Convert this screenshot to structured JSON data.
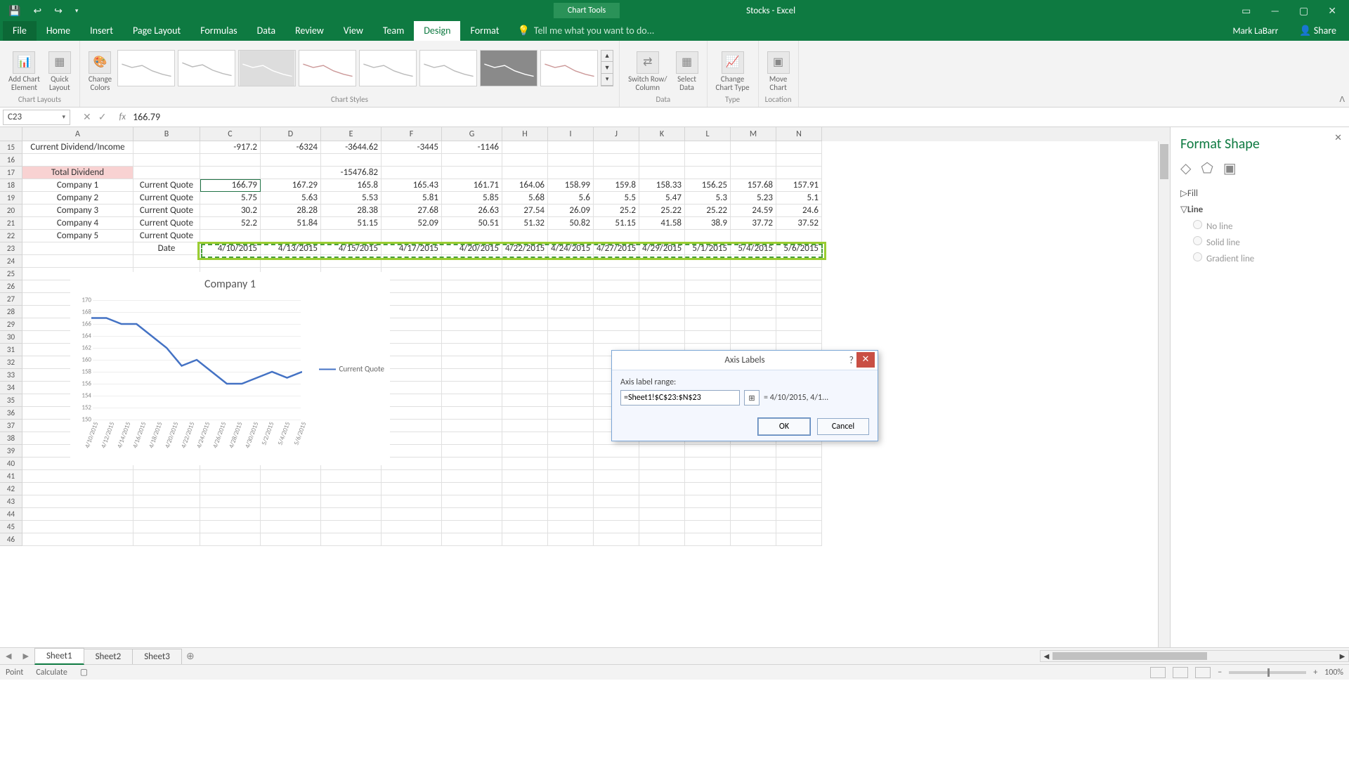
{
  "window": {
    "contextual_label": "Chart Tools",
    "title": "Stocks - Excel",
    "user": "Mark LaBarr",
    "share": "Share"
  },
  "tabs": {
    "file": "File",
    "home": "Home",
    "insert": "Insert",
    "pagelayout": "Page Layout",
    "formulas": "Formulas",
    "data": "Data",
    "review": "Review",
    "view": "View",
    "team": "Team",
    "design": "Design",
    "format": "Format",
    "tellme": "Tell me what you want to do..."
  },
  "ribbon": {
    "add_chart_element": "Add Chart\nElement",
    "quick_layout": "Quick\nLayout",
    "change_colors": "Change\nColors",
    "group_chart_layouts": "Chart Layouts",
    "group_chart_styles": "Chart Styles",
    "switch_row": "Switch Row/\nColumn",
    "select_data": "Select\nData",
    "group_data": "Data",
    "change_type": "Change\nChart Type",
    "group_type": "Type",
    "move_chart": "Move\nChart",
    "group_location": "Location"
  },
  "namebox": "C23",
  "formula": "166.79",
  "columns": [
    "A",
    "B",
    "C",
    "D",
    "E",
    "F",
    "G",
    "H",
    "I",
    "J",
    "K",
    "L",
    "M",
    "N"
  ],
  "row_numbers": [
    15,
    16,
    17,
    18,
    19,
    20,
    21,
    22,
    23,
    24,
    25,
    26,
    27,
    28,
    29,
    30,
    31,
    32,
    33,
    34,
    35,
    36,
    37,
    38,
    39,
    40,
    41,
    42,
    43,
    44,
    45,
    46
  ],
  "cells": {
    "r15": {
      "A": "Current Dividend/Income",
      "C": "-917.2",
      "D": "-6324",
      "E": "-3644.62",
      "F": "-3445",
      "G": "-1146"
    },
    "r17": {
      "A": "Total Dividend",
      "E": "-15476.82"
    },
    "r18": {
      "A": "Company 1",
      "B": "Current Quote",
      "C": "166.79",
      "D": "167.29",
      "E": "165.8",
      "F": "165.43",
      "G": "161.71",
      "H": "164.06",
      "I": "158.99",
      "J": "159.8",
      "K": "158.33",
      "L": "156.25",
      "M": "157.68",
      "N": "157.91"
    },
    "r19": {
      "A": "Company 2",
      "B": "Current Quote",
      "C": "5.75",
      "D": "5.63",
      "E": "5.53",
      "F": "5.81",
      "G": "5.85",
      "H": "5.68",
      "I": "5.6",
      "J": "5.5",
      "K": "5.47",
      "L": "5.3",
      "M": "5.23",
      "N": "5.1"
    },
    "r20": {
      "A": "Company 3",
      "B": "Current Quote",
      "C": "30.2",
      "D": "28.28",
      "E": "28.38",
      "F": "27.68",
      "G": "26.63",
      "H": "27.54",
      "I": "26.09",
      "J": "25.2",
      "K": "25.22",
      "L": "25.22",
      "M": "24.59",
      "N": "24.6"
    },
    "r21": {
      "A": "Company 4",
      "B": "Current Quote",
      "C": "52.2",
      "D": "51.84",
      "E": "51.15",
      "F": "52.09",
      "G": "50.51",
      "H": "51.32",
      "I": "50.82",
      "J": "51.15",
      "K": "41.58",
      "L": "38.9",
      "M": "37.72",
      "N": "37.52"
    },
    "r22": {
      "A": "Company 5",
      "B": "Current Quote"
    },
    "r23": {
      "B": "Date",
      "C": "4/10/2015",
      "D": "4/13/2015",
      "E": "4/15/2015",
      "F": "4/17/2015",
      "G": "4/20/2015",
      "H": "4/22/2015",
      "I": "4/24/2015",
      "J": "4/27/2015",
      "K": "4/29/2015",
      "L": "5/1/2015",
      "M": "5/4/2015",
      "N": "5/6/2015"
    }
  },
  "chart_data": {
    "type": "line",
    "title": "Company 1",
    "series": [
      {
        "name": "Current Quote",
        "values": [
          167,
          167,
          166,
          166,
          164,
          162,
          159,
          160,
          158,
          156,
          156,
          157,
          158,
          157,
          158
        ]
      }
    ],
    "categories": [
      "4/10/2015",
      "4/12/2015",
      "4/14/2015",
      "4/16/2015",
      "4/18/2015",
      "4/20/2015",
      "4/22/2015",
      "4/24/2015",
      "4/26/2015",
      "4/28/2015",
      "4/30/2015",
      "5/2/2015",
      "5/4/2015",
      "5/6/2015"
    ],
    "yticks": [
      150,
      152,
      154,
      156,
      158,
      160,
      162,
      164,
      166,
      168,
      170
    ],
    "ylim": [
      150,
      170
    ],
    "legend": "Current Quote"
  },
  "format_pane": {
    "title": "Format Shape",
    "fill": "Fill",
    "line": "Line",
    "no_line": "No line",
    "solid_line": "Solid line",
    "gradient_line": "Gradient line"
  },
  "dialog": {
    "title": "Axis Labels",
    "label": "Axis label range:",
    "value": "=Sheet1!$C$23:$N$23",
    "preview": "= 4/10/2015, 4/1...",
    "ok": "OK",
    "cancel": "Cancel"
  },
  "sheets": {
    "s1": "Sheet1",
    "s2": "Sheet2",
    "s3": "Sheet3"
  },
  "status": {
    "mode": "Point",
    "calc": "Calculate",
    "zoom": "100%"
  }
}
